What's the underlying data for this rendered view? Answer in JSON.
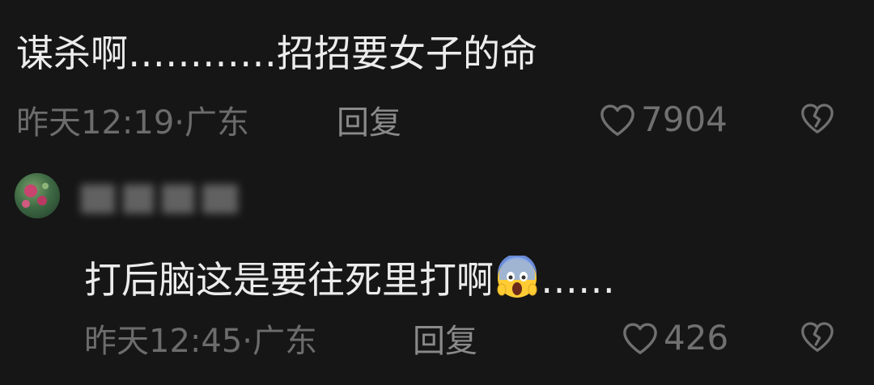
{
  "comments": [
    {
      "text": "谋杀啊…………招招要女子的命",
      "time": "昨天12:19",
      "location": "广东",
      "reply_label": "回复",
      "likes": "7904",
      "like_icon": "heart-outline-icon",
      "dislike_icon": "broken-heart-icon"
    },
    {
      "username": "",
      "text_before_emoji": "打后脑这是要往死里打啊",
      "emoji": "screaming-face-emoji",
      "text_after_emoji": "……",
      "time": "昨天12:45",
      "location": "广东",
      "reply_label": "回复",
      "likes": "426",
      "like_icon": "heart-outline-icon",
      "dislike_icon": "broken-heart-icon"
    }
  ],
  "separator": "·",
  "colors": {
    "background": "#161616",
    "text": "#ececec",
    "meta": "#6c6c6c",
    "icon": "#707070"
  }
}
